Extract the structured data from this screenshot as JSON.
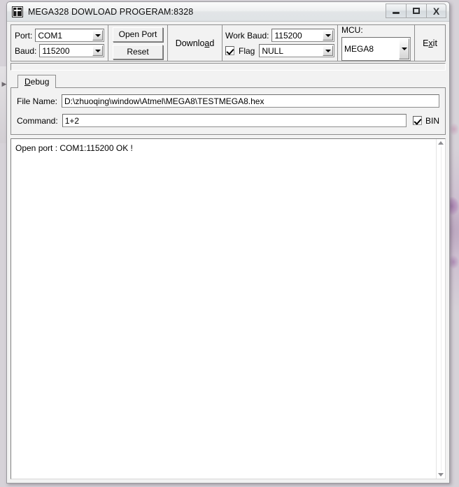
{
  "window": {
    "title": "MEGA328 DOWLOAD PROGERAM:8328",
    "icon": "chip-icon",
    "controls": {
      "minimize": "minimize-icon",
      "maximize": "maximize-icon",
      "close": "X"
    }
  },
  "toolbar": {
    "port_label": "Port:",
    "port_value": "COM1",
    "baud_label": "Baud:",
    "baud_value": "115200",
    "open_port_label": "Open Port",
    "reset_label": "Reset",
    "download_label_pre": "Downlo",
    "download_label_accel": "a",
    "download_label_post": "d",
    "work_baud_label": "Work Baud:",
    "work_baud_value": "115200",
    "flag_label": "Flag",
    "flag_checked": true,
    "null_value": "NULL",
    "mcu_label": "MCU:",
    "mcu_value": "MEGA8",
    "exit_label_pre": "E",
    "exit_label_accel": "x",
    "exit_label_post": "it"
  },
  "tabs": {
    "items": [
      {
        "label_accel": "D",
        "label_rest": "ebug",
        "active": true
      }
    ]
  },
  "form": {
    "file_name_label": "File Name:",
    "file_name_value": "D:\\zhuoqing\\window\\Atmel\\MEGA8\\TESTMEGA8.hex",
    "command_label": "Command:",
    "command_value": "1+2",
    "bin_label": "BIN",
    "bin_checked": true
  },
  "log": {
    "text": "Open port : COM1:115200 OK !"
  },
  "colors": {
    "window_face": "#f0f0f0",
    "client_face": "#f2f2f2",
    "border": "#8d8d8d",
    "field_bg": "#ffffff",
    "text": "#000000"
  }
}
